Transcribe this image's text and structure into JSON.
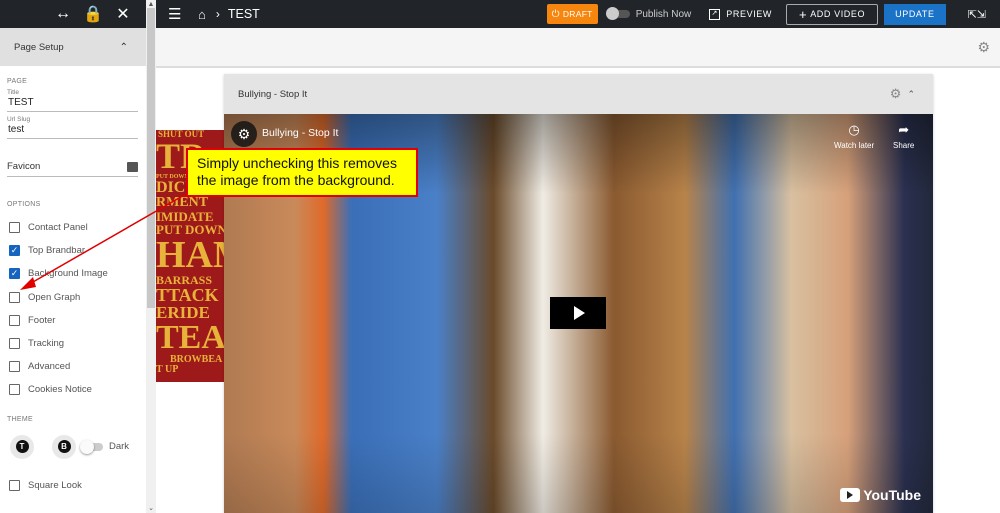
{
  "sidebar": {
    "top_icons": [
      "resize-horizontal-icon",
      "lock-icon",
      "close-icon"
    ],
    "section_title": "Page Setup",
    "page_label": "PAGE",
    "title_field": {
      "label": "Title",
      "value": "TEST"
    },
    "slug_field": {
      "label": "Url Slug",
      "value": "test"
    },
    "favicon_label": "Favicon",
    "options_label": "OPTIONS",
    "options": [
      {
        "label": "Contact Panel",
        "checked": false
      },
      {
        "label": "Top Brandbar",
        "checked": true
      },
      {
        "label": "Background Image",
        "checked": true
      },
      {
        "label": "Open Graph",
        "checked": false
      },
      {
        "label": "Footer",
        "checked": false
      },
      {
        "label": "Tracking",
        "checked": false
      },
      {
        "label": "Advanced",
        "checked": false
      },
      {
        "label": "Cookies Notice",
        "checked": false
      }
    ],
    "theme_label": "THEME",
    "theme_buttons": [
      "T",
      "B"
    ],
    "dark_label": "Dark",
    "dark_enabled": false,
    "square_look": {
      "label": "Square Look",
      "checked": false
    }
  },
  "topbar": {
    "breadcrumb_title": "TEST",
    "draft_label": "DRAFT",
    "publish_label": "Publish Now",
    "publish_enabled": false,
    "preview_label": "PREVIEW",
    "add_video_label": "ADD VIDEO",
    "update_label": "UPDATE"
  },
  "background_words": [
    "SHUT OUT",
    "TR",
    "PUT DOWN",
    "DICUL",
    "RMENT",
    "IMIDATE",
    "PUT DOWN",
    "HAM",
    "BARRASS",
    "TTACK",
    "ERIDE",
    "TEAS",
    "BROWBEA",
    "T UP"
  ],
  "card": {
    "title": "Bullying - Stop It"
  },
  "video": {
    "title": "Bullying - Stop It",
    "watch_later": "Watch later",
    "share": "Share",
    "brand": "YouTube"
  },
  "callout": {
    "line1": "Simply unchecking this removes",
    "line2": "the image from the background."
  },
  "colors": {
    "topbar": "#212529",
    "draft": "#f7860f",
    "update": "#1a73c6",
    "checkbox": "#1565c0",
    "callout_bg": "#ffff00",
    "callout_border": "#e00000"
  }
}
